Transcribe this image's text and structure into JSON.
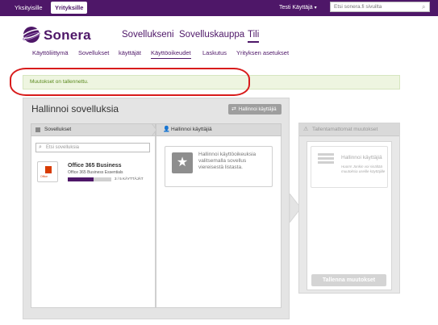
{
  "topbar": {
    "segment_private": "Yksityisille",
    "segment_business": "Yrityksille",
    "user": "Testi Käyttäjä",
    "search_placeholder": "Etsi sonera.fi sivuilta"
  },
  "brand": {
    "logo_text": "Sonera"
  },
  "main_nav": [
    "Sovellukseni",
    "Sovelluskauppa",
    "Tili"
  ],
  "sub_nav": [
    "Käyttöliittymä",
    "Sovellukset",
    "käyttäjät",
    "Käyttöoikeudet",
    "Laskutus",
    "Yrityksen asetukset"
  ],
  "message": {
    "text": "Muutokset on tallennettu."
  },
  "manage": {
    "title": "Hallinnoi sovelluksia",
    "manage_users_button": "Hallinnoi käyttäjiä",
    "apps_header": "Sovellukset",
    "users_header": "Hallinnoi käyttäjiä",
    "app_search_placeholder": "Etsi sovelluksia",
    "app": {
      "name": "Office 365 Business",
      "subtitle": "Office 365 Business Essentials",
      "icon_label": "Office",
      "progress": 0.6,
      "count_text": "3 / 5 KÄYTTÄJÄT"
    },
    "users_hint": "Hallinnoi käyttöoikeuksia valitsemalla sovellus viereisestä listasta."
  },
  "pending": {
    "header": "Tallentamattomat muutokset",
    "box_title": "Hallinnoi käyttäjiä",
    "box_text": "Huom! Jonkin voi sisältää muutoksia useille käyttäjille",
    "save_button": "Tallenna muutokset"
  },
  "colors": {
    "brand_purple": "#4e1768",
    "success_bg": "#eef5e0",
    "success_text": "#5b8a1e",
    "highlight_red": "#d81b1b"
  }
}
